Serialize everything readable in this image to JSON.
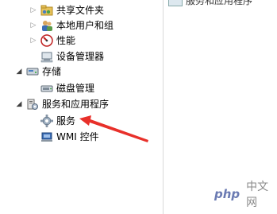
{
  "tree": {
    "items": [
      {
        "label": "共享文件夹",
        "icon": "shared-folder-icon",
        "expander": "collapsed"
      },
      {
        "label": "本地用户和组",
        "icon": "users-group-icon",
        "expander": "collapsed"
      },
      {
        "label": "性能",
        "icon": "performance-icon",
        "expander": "collapsed"
      },
      {
        "label": "设备管理器",
        "icon": "device-manager-icon",
        "expander": "none"
      },
      {
        "label": "存储",
        "icon": "storage-icon",
        "expander": "expanded"
      },
      {
        "label": "磁盘管理",
        "icon": "disk-management-icon",
        "expander": "none"
      },
      {
        "label": "服务和应用程序",
        "icon": "services-apps-icon",
        "expander": "expanded"
      },
      {
        "label": "服务",
        "icon": "gear-icon",
        "expander": "none"
      },
      {
        "label": "WMI 控件",
        "icon": "wmi-control-icon",
        "expander": "none"
      }
    ]
  },
  "right_pane": {
    "item_label": "服务和应用程序"
  },
  "annotation": {
    "arrow_color": "#e8302a",
    "points_to": "服务"
  },
  "watermark": {
    "brand": "php",
    "text": "中文网"
  }
}
